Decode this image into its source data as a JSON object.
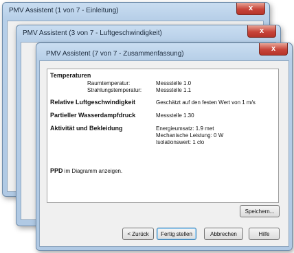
{
  "windows": {
    "back": {
      "title": "PMV Assistent (1 von 7 - Einleitung)",
      "close": "x"
    },
    "middle": {
      "title": "PMV Assistent (3 von 7 - Luftgeschwindigkeit)",
      "close": "x"
    },
    "front": {
      "title": "PMV Assistent (7 von 7 - Zusammenfassung)",
      "close": "x"
    }
  },
  "summary": {
    "temperature": {
      "heading": "Temperaturen",
      "room_label": "Raumtemperatur:",
      "room_value": "Messstelle 1.0",
      "radiant_label": "Strahlungstemperatur:",
      "radiant_value": "Messstelle 1.1"
    },
    "air_speed": {
      "heading": "Relative Luftgeschwindigkeit",
      "value": "Geschätzt auf den festen Wert von 1 m/s"
    },
    "vapor": {
      "heading": "Partieller Wasserdampfdruck",
      "value": "Messstelle 1.30"
    },
    "activity": {
      "heading": "Aktivität und Bekleidung",
      "line1": "Energieumsatz: 1.9 met",
      "line2": "Mechanische Leistung: 0 W",
      "line3": "Isolationswert: 1 clo"
    },
    "ppd": {
      "bold": "PPD",
      "rest": "im Diagramm anzeigen."
    }
  },
  "buttons": {
    "save": "Speichern...",
    "back": "< Zurück",
    "finish": "Fertig stellen",
    "cancel": "Abbrechen",
    "help": "Hilfe"
  }
}
